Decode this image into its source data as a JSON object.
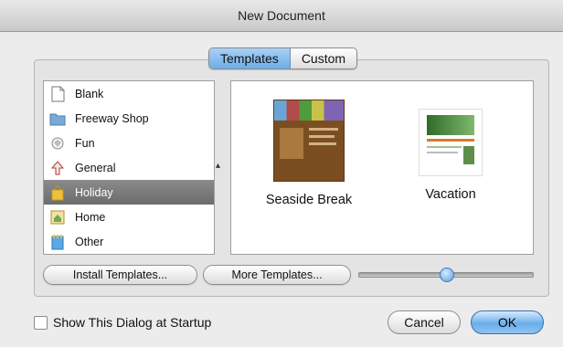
{
  "window": {
    "title": "New Document"
  },
  "tabs": [
    {
      "label": "Templates",
      "active": true
    },
    {
      "label": "Custom",
      "active": false
    }
  ],
  "categories": [
    {
      "label": "Blank",
      "icon": "blank-document-icon"
    },
    {
      "label": "Freeway Shop",
      "icon": "folder-icon"
    },
    {
      "label": "Fun",
      "icon": "fun-icon"
    },
    {
      "label": "General",
      "icon": "general-arrow-icon"
    },
    {
      "label": "Holiday",
      "icon": "holiday-icon",
      "selected": true
    },
    {
      "label": "Home",
      "icon": "home-icon"
    },
    {
      "label": "Other",
      "icon": "other-icon"
    }
  ],
  "templates": [
    {
      "label": "Seaside Break",
      "thumbnail": "seaside-break-thumbnail"
    },
    {
      "label": "Vacation",
      "thumbnail": "vacation-thumbnail"
    }
  ],
  "buttons": {
    "install": "Install Templates...",
    "more": "More Templates...",
    "cancel": "Cancel",
    "ok": "OK"
  },
  "slider": {
    "value_fraction": 0.5
  },
  "startup_checkbox": {
    "label": "Show This Dialog at Startup",
    "checked": false
  },
  "colors": {
    "accent": "#6aaee9",
    "selection": "#7a7a7a"
  }
}
